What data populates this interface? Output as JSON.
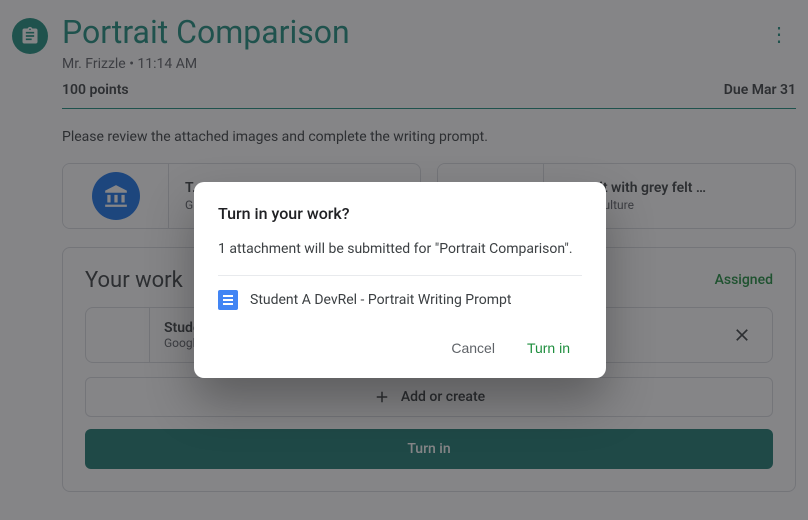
{
  "header": {
    "title": "Portrait Comparison",
    "teacher": "Mr. Frizzle",
    "time": "11:14 AM",
    "byline_sep": " • ",
    "points": "100 points",
    "due": "Due Mar 31"
  },
  "description": "Please review the attached images and complete the writing prompt.",
  "attachments": [
    {
      "title": "T…",
      "subtitle": "G…"
    },
    {
      "title": "Portrait with grey felt …",
      "subtitle": "Arts & Culture"
    }
  ],
  "work": {
    "heading": "Your work",
    "status": "Assigned",
    "file": {
      "title": "Studer…",
      "subtitle": "Google …"
    },
    "add_label": "Add or create",
    "turnin_label": "Turn in"
  },
  "dialog": {
    "title": "Turn in your work?",
    "message": "1 attachment will be submitted for \"Portrait Comparison\".",
    "file_name": "Student A DevRel - Portrait Writing Prompt",
    "cancel": "Cancel",
    "confirm": "Turn in"
  }
}
